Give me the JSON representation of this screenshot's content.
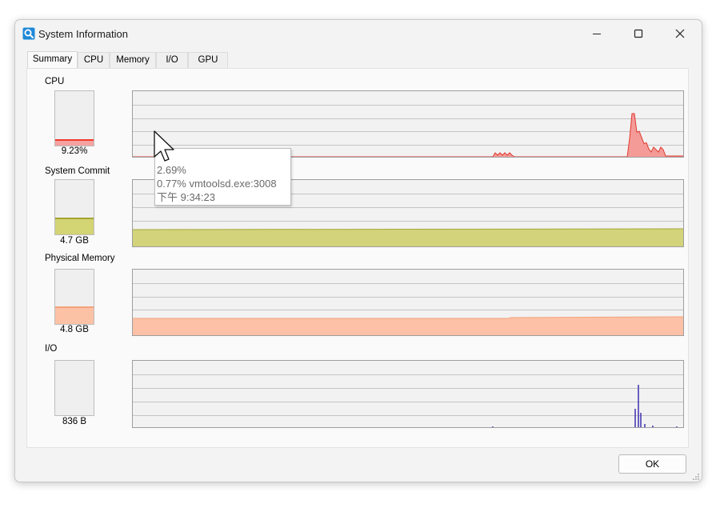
{
  "window": {
    "title": "System Information",
    "app_icon": "system-info-icon"
  },
  "titlebar_buttons": [
    "minimize-icon",
    "maximize-icon",
    "close-icon"
  ],
  "tabs": [
    {
      "label": "Summary",
      "active": true
    },
    {
      "label": "CPU",
      "active": false
    },
    {
      "label": "Memory",
      "active": false
    },
    {
      "label": "I/O",
      "active": false
    },
    {
      "label": "GPU",
      "active": false
    }
  ],
  "sections": {
    "cpu": {
      "label": "CPU",
      "value": "9.23%",
      "fill": 0.0923,
      "color": "#f0392b",
      "fill_color": "#f5a3a1"
    },
    "commit": {
      "label": "System Commit",
      "value": "4.7 GB",
      "fill": 0.28,
      "color": "#a3a632",
      "fill_color": "#d3d474"
    },
    "memory": {
      "label": "Physical Memory",
      "value": "4.8 GB",
      "fill": 0.3,
      "color": "#f4a37b",
      "fill_color": "#fcc2a5"
    },
    "io": {
      "label": "I/O",
      "value": "836 B",
      "fill": 0.0,
      "color": "#3c2fb0",
      "fill_color": "#3c2fb0"
    }
  },
  "tooltip": {
    "line1": "2.69%",
    "line2": "0.77% vmtoolsd.exe:3008",
    "line3": "下午 9:34:23"
  },
  "ok_label": "OK"
}
